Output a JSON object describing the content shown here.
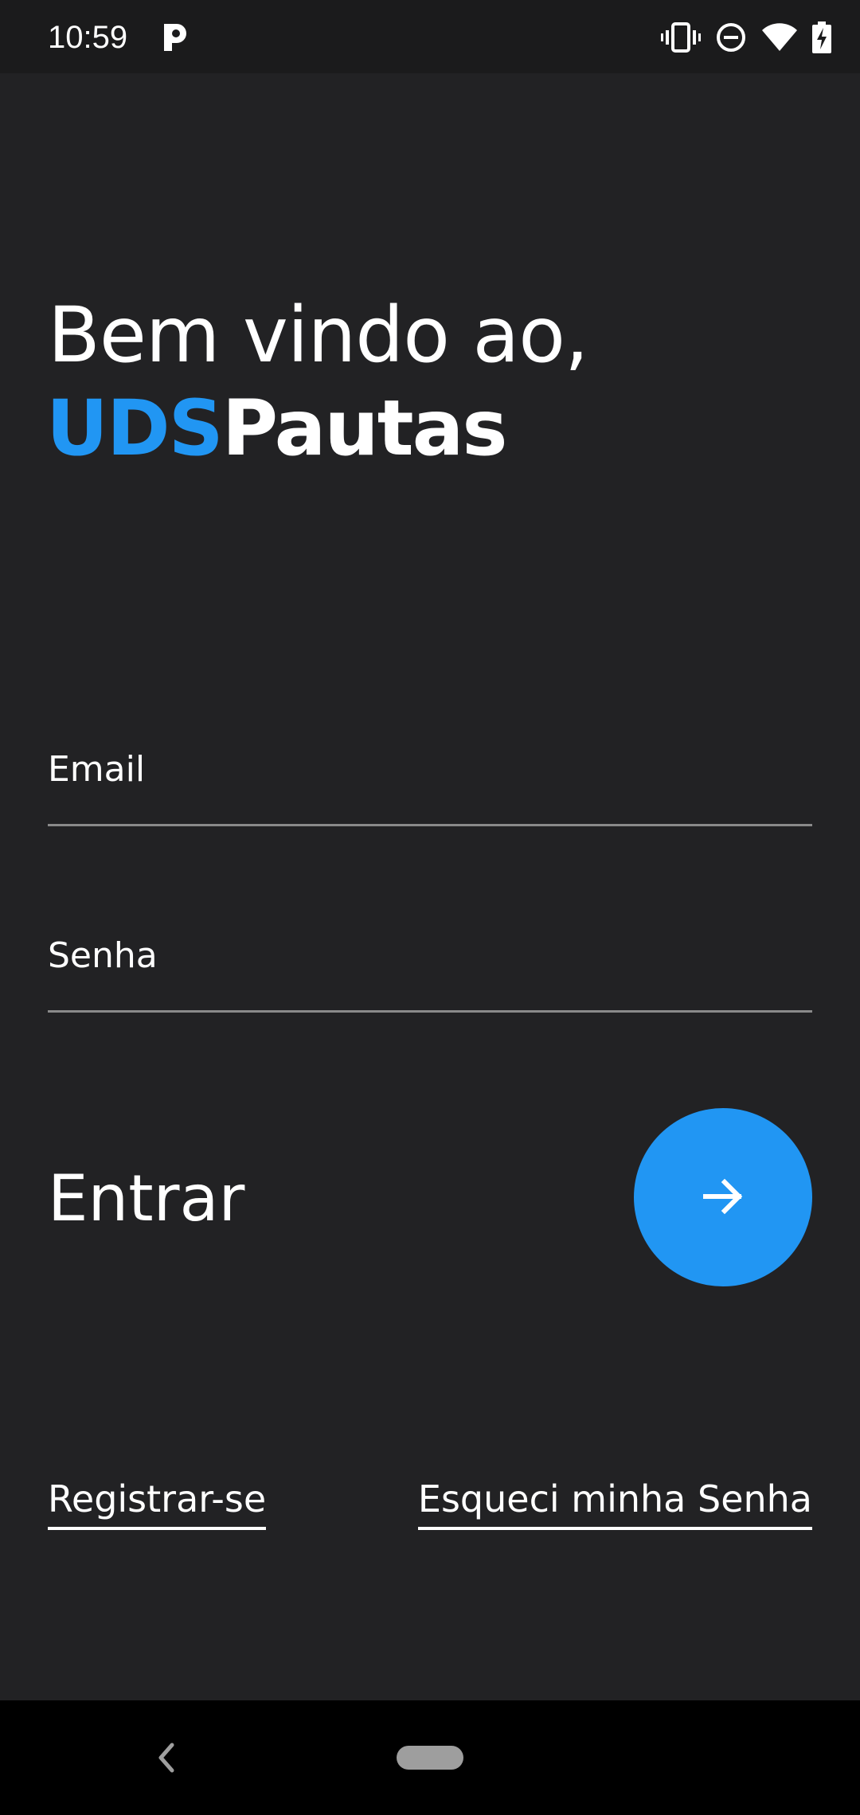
{
  "status_bar": {
    "time": "10:59",
    "app_icon": "p-app-icon",
    "icons": [
      "vibrate-icon",
      "do-not-disturb-icon",
      "wifi-icon",
      "battery-charging-icon"
    ]
  },
  "welcome": {
    "greeting": "Bem vindo ao,",
    "brand_accent": "UDS",
    "brand_rest": "Pautas"
  },
  "form": {
    "email_label": "Email",
    "email_value": "",
    "password_label": "Senha",
    "password_value": ""
  },
  "enter": {
    "label": "Entrar",
    "button_icon": "arrow-right-icon"
  },
  "links": {
    "register": "Registrar-se",
    "forgot_password": "Esqueci minha Senha"
  },
  "navigation": {
    "back_icon": "back-chevron-icon",
    "home_pill": "home-pill"
  },
  "colors": {
    "background": "#222224",
    "accent": "#2196f3",
    "text": "#ffffff",
    "underline": "#8a8a8a"
  }
}
